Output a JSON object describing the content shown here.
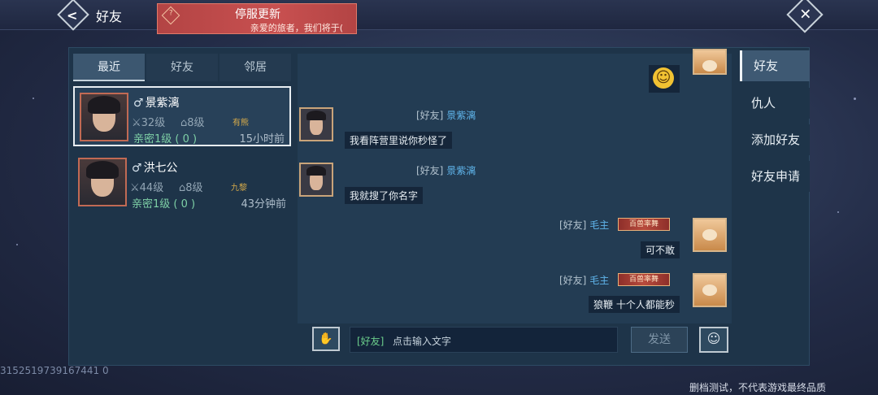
{
  "header": {
    "title": "好友",
    "back_icon": "back-arrow-icon",
    "close_icon": "close-x-icon"
  },
  "notice": {
    "title": "停服更新",
    "text": "亲爱的旅者，我们将于(",
    "icon": "question-icon"
  },
  "tabs": [
    {
      "label": "最近",
      "active": true
    },
    {
      "label": "好友",
      "active": false
    },
    {
      "label": "邻居",
      "active": false
    }
  ],
  "friends": [
    {
      "gender": "♂",
      "name": "景紫漓",
      "power": "32级",
      "house": "8级",
      "guild": "有熊",
      "intimacy": "亲密1级 ( 0 )",
      "last_seen": "15小时前",
      "selected": true
    },
    {
      "gender": "♂",
      "name": "洪七公",
      "power": "44级",
      "house": "8级",
      "guild": "九黎",
      "intimacy": "亲密1级 ( 0 )",
      "last_seen": "43分钟前",
      "selected": false
    }
  ],
  "chat": {
    "messages": [
      {
        "side": "right",
        "type": "emoji",
        "emoji": "smile-icon"
      },
      {
        "side": "left",
        "channel": "[好友]",
        "name": "景紫漓",
        "text": "我看阵营里说你秒怪了"
      },
      {
        "side": "left",
        "channel": "[好友]",
        "name": "景紫漓",
        "text": "我就搜了你名字"
      },
      {
        "side": "right",
        "channel": "[好友]",
        "name": "毛主",
        "badge": "百兽率舞",
        "text": "可不敢"
      },
      {
        "side": "right",
        "channel": "[好友]",
        "name": "毛主",
        "badge": "百兽率舞",
        "text": "狼鞭 十个人都能秒"
      }
    ],
    "input": {
      "channel": "[好友]",
      "placeholder": "点击输入文字"
    },
    "send_label": "发送"
  },
  "side_menu": [
    {
      "label": "好友",
      "active": true
    },
    {
      "label": "仇人",
      "active": false
    },
    {
      "label": "添加好友",
      "active": false
    },
    {
      "label": "好友申请",
      "active": false
    }
  ],
  "uid": "3152519739167441 0",
  "disclaimer": "删档测试，不代表游戏最终品质",
  "colors": {
    "accent_name": "#5fb4ea",
    "intimacy": "#7ed0a6",
    "notice_bg": "#c85050",
    "panel_bg": "#1e3449"
  }
}
